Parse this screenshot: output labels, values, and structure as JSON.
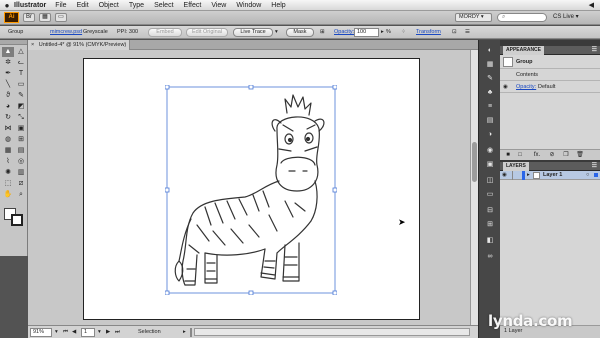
{
  "menubar": {
    "apple": "",
    "app_name": "Illustrator",
    "menus": [
      "File",
      "Edit",
      "Object",
      "Type",
      "Select",
      "Effect",
      "View",
      "Window",
      "Help"
    ],
    "right_glyph": "◀"
  },
  "appbar": {
    "logo": "Ai",
    "workspace": "MORDY ▾",
    "search_placeholder": "",
    "cs_live": "CS Live ▾"
  },
  "controlbar": {
    "selection_type": "Group",
    "linked_file": "mimcrew.psd",
    "color_mode": "Greyscale",
    "ppi": "PPI: 300",
    "embed_button": "Embed",
    "edit_original_button": "Edit Original",
    "live_trace_button": "Live Trace",
    "mask_button": "Mask",
    "opacity_label": "Opacity:",
    "opacity_value": "100",
    "opacity_unit": "%",
    "transform_label": "Transform"
  },
  "document": {
    "tab_close": "×",
    "tab_title": "Untitled-4* @ 91% (CMYK/Preview)"
  },
  "tools": [
    {
      "icon": "selection-tool-icon",
      "glyph": "▲"
    },
    {
      "icon": "direct-selection-tool-icon",
      "glyph": "△"
    },
    {
      "icon": "magic-wand-icon",
      "glyph": "✲"
    },
    {
      "icon": "lasso-icon",
      "glyph": "ᓚ"
    },
    {
      "icon": "pen-tool-icon",
      "glyph": "✒"
    },
    {
      "icon": "type-tool-icon",
      "glyph": "T"
    },
    {
      "icon": "line-tool-icon",
      "glyph": "╲"
    },
    {
      "icon": "rectangle-tool-icon",
      "glyph": "▭"
    },
    {
      "icon": "paintbrush-icon",
      "glyph": "ϑ"
    },
    {
      "icon": "pencil-icon",
      "glyph": "✎"
    },
    {
      "icon": "blob-brush-icon",
      "glyph": "◕"
    },
    {
      "icon": "eraser-icon",
      "glyph": "◩"
    },
    {
      "icon": "rotate-icon",
      "glyph": "↻"
    },
    {
      "icon": "scale-icon",
      "glyph": "⤡"
    },
    {
      "icon": "width-icon",
      "glyph": "⋈"
    },
    {
      "icon": "free-transform-icon",
      "glyph": "▣"
    },
    {
      "icon": "shape-builder-icon",
      "glyph": "◍"
    },
    {
      "icon": "perspective-grid-icon",
      "glyph": "⊞"
    },
    {
      "icon": "mesh-icon",
      "glyph": "▦"
    },
    {
      "icon": "gradient-icon",
      "glyph": "▤"
    },
    {
      "icon": "eyedropper-icon",
      "glyph": "⌇"
    },
    {
      "icon": "blend-icon",
      "glyph": "◎"
    },
    {
      "icon": "symbol-sprayer-icon",
      "glyph": "✺"
    },
    {
      "icon": "column-graph-icon",
      "glyph": "▥"
    },
    {
      "icon": "artboard-icon",
      "glyph": "⬚"
    },
    {
      "icon": "slice-icon",
      "glyph": "⧄"
    },
    {
      "icon": "hand-icon",
      "glyph": "✋"
    },
    {
      "icon": "zoom-icon",
      "glyph": "⌕"
    }
  ],
  "status": {
    "zoom": "91%",
    "artboard_number": "1",
    "tool_name": "Selection"
  },
  "appearance_panel": {
    "tab_label": "APPEARANCE",
    "object_type": "Group",
    "contents_label": "Contents",
    "opacity_label": "Opacity:",
    "opacity_value": "Default",
    "fx_label": "fx."
  },
  "layers_panel": {
    "tab_label": "LAYERS",
    "layer_name": "Layer 1",
    "layer_count": "1 Layer"
  },
  "watermark": "lynda.com",
  "colors": {
    "selection_blue": "#4a78d6",
    "pasteboard": "#c8c8c8",
    "panel_dark": "#3a3a3a",
    "layer_highlight": "#b7c9e3",
    "layer_color": "#2b66e8"
  }
}
